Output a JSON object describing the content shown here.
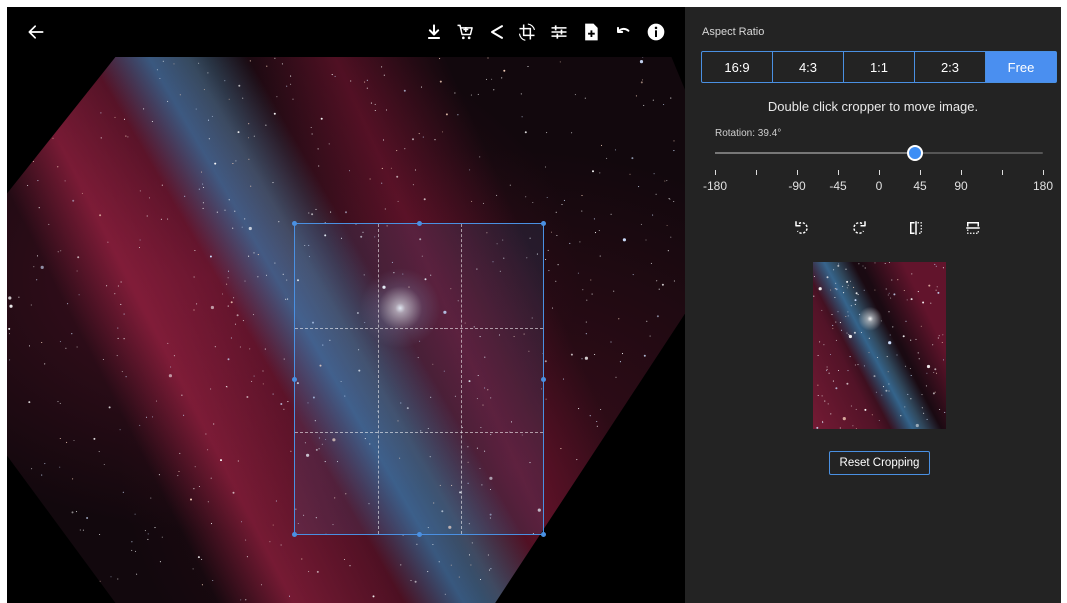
{
  "toolbar": {
    "icons": [
      "back-arrow-icon",
      "download-icon",
      "cart-icon",
      "share-icon",
      "crop-rotate-icon",
      "adjust-sliders-icon",
      "add-file-icon",
      "undo-icon",
      "info-icon"
    ]
  },
  "panel": {
    "aspect_label": "Aspect Ratio",
    "ratios": [
      {
        "label": "16:9",
        "active": false
      },
      {
        "label": "4:3",
        "active": false
      },
      {
        "label": "1:1",
        "active": false
      },
      {
        "label": "2:3",
        "active": false
      },
      {
        "label": "Free",
        "active": true
      }
    ],
    "hint": "Double click cropper to move image.",
    "rotation_label": "Rotation: 39.4°",
    "rotation_value": 39.4,
    "rotation_min": -180,
    "rotation_max": 180,
    "ticks": [
      "-180",
      "",
      "-90",
      "-45",
      "0",
      "45",
      "90",
      "",
      "180"
    ],
    "tools": [
      "rotate-left-icon",
      "rotate-right-icon",
      "flip-horizontal-icon",
      "flip-vertical-icon"
    ],
    "reset_label": "Reset Cropping"
  },
  "colors": {
    "accent": "#4a8ff0",
    "panel_bg": "#232323",
    "canvas_bg": "#000000"
  }
}
